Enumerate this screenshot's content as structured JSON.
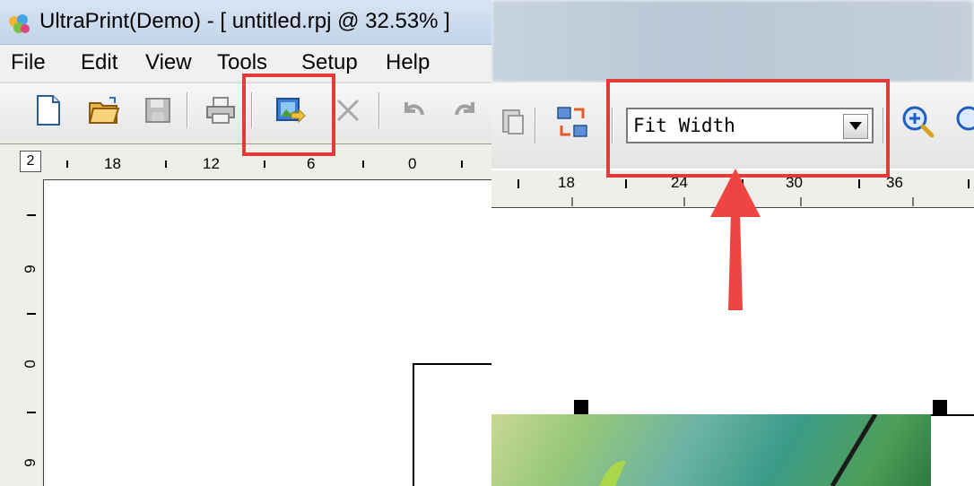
{
  "window": {
    "title": "UltraPrint(Demo) - [ untitled.rpj @ 32.53% ]"
  },
  "menu": [
    "File",
    "Edit",
    "View",
    "Tools",
    "Setup",
    "Help"
  ],
  "toolbar": {
    "icons": [
      "new-document-icon",
      "open-folder-icon",
      "save-icon",
      "print-icon",
      "import-image-icon",
      "delete-icon",
      "undo-icon",
      "redo-icon",
      "paste-icon",
      "rotate-page-icon",
      "zoom-in-icon"
    ]
  },
  "zoom": {
    "selected": "Fit Width"
  },
  "left_ruler": {
    "page_number": "2",
    "h_labels": [
      "18",
      "12",
      "6",
      "0"
    ],
    "v_labels": [
      "6",
      "0",
      "6"
    ]
  },
  "right_ruler": {
    "h_labels": [
      "18",
      "24",
      "30",
      "36"
    ]
  },
  "colors": {
    "highlight": "#e53a3a",
    "toolbar_bg": "#ececec"
  }
}
